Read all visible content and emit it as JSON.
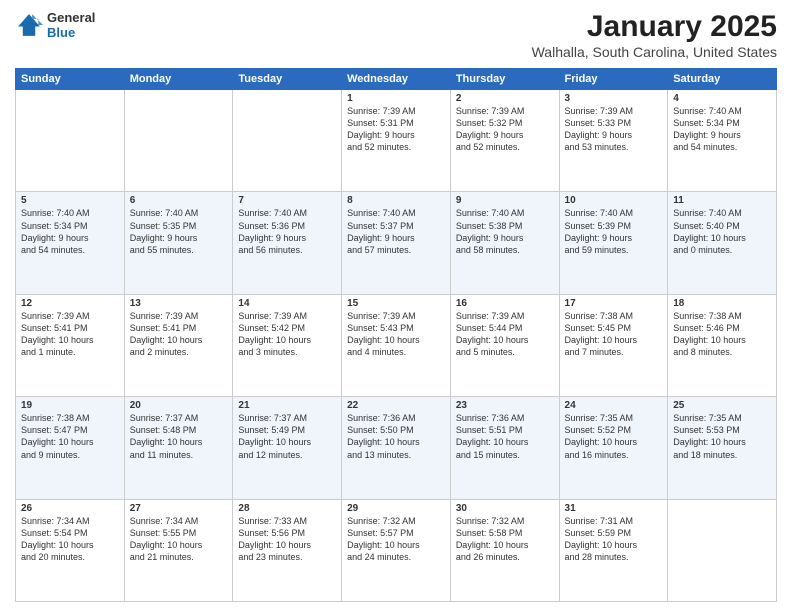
{
  "header": {
    "logo_line1": "General",
    "logo_line2": "Blue",
    "title": "January 2025",
    "subtitle": "Walhalla, South Carolina, United States"
  },
  "days_of_week": [
    "Sunday",
    "Monday",
    "Tuesday",
    "Wednesday",
    "Thursday",
    "Friday",
    "Saturday"
  ],
  "weeks": [
    [
      {
        "day": "",
        "info": ""
      },
      {
        "day": "",
        "info": ""
      },
      {
        "day": "",
        "info": ""
      },
      {
        "day": "1",
        "info": "Sunrise: 7:39 AM\nSunset: 5:31 PM\nDaylight: 9 hours\nand 52 minutes."
      },
      {
        "day": "2",
        "info": "Sunrise: 7:39 AM\nSunset: 5:32 PM\nDaylight: 9 hours\nand 52 minutes."
      },
      {
        "day": "3",
        "info": "Sunrise: 7:39 AM\nSunset: 5:33 PM\nDaylight: 9 hours\nand 53 minutes."
      },
      {
        "day": "4",
        "info": "Sunrise: 7:40 AM\nSunset: 5:34 PM\nDaylight: 9 hours\nand 54 minutes."
      }
    ],
    [
      {
        "day": "5",
        "info": "Sunrise: 7:40 AM\nSunset: 5:34 PM\nDaylight: 9 hours\nand 54 minutes."
      },
      {
        "day": "6",
        "info": "Sunrise: 7:40 AM\nSunset: 5:35 PM\nDaylight: 9 hours\nand 55 minutes."
      },
      {
        "day": "7",
        "info": "Sunrise: 7:40 AM\nSunset: 5:36 PM\nDaylight: 9 hours\nand 56 minutes."
      },
      {
        "day": "8",
        "info": "Sunrise: 7:40 AM\nSunset: 5:37 PM\nDaylight: 9 hours\nand 57 minutes."
      },
      {
        "day": "9",
        "info": "Sunrise: 7:40 AM\nSunset: 5:38 PM\nDaylight: 9 hours\nand 58 minutes."
      },
      {
        "day": "10",
        "info": "Sunrise: 7:40 AM\nSunset: 5:39 PM\nDaylight: 9 hours\nand 59 minutes."
      },
      {
        "day": "11",
        "info": "Sunrise: 7:40 AM\nSunset: 5:40 PM\nDaylight: 10 hours\nand 0 minutes."
      }
    ],
    [
      {
        "day": "12",
        "info": "Sunrise: 7:39 AM\nSunset: 5:41 PM\nDaylight: 10 hours\nand 1 minute."
      },
      {
        "day": "13",
        "info": "Sunrise: 7:39 AM\nSunset: 5:41 PM\nDaylight: 10 hours\nand 2 minutes."
      },
      {
        "day": "14",
        "info": "Sunrise: 7:39 AM\nSunset: 5:42 PM\nDaylight: 10 hours\nand 3 minutes."
      },
      {
        "day": "15",
        "info": "Sunrise: 7:39 AM\nSunset: 5:43 PM\nDaylight: 10 hours\nand 4 minutes."
      },
      {
        "day": "16",
        "info": "Sunrise: 7:39 AM\nSunset: 5:44 PM\nDaylight: 10 hours\nand 5 minutes."
      },
      {
        "day": "17",
        "info": "Sunrise: 7:38 AM\nSunset: 5:45 PM\nDaylight: 10 hours\nand 7 minutes."
      },
      {
        "day": "18",
        "info": "Sunrise: 7:38 AM\nSunset: 5:46 PM\nDaylight: 10 hours\nand 8 minutes."
      }
    ],
    [
      {
        "day": "19",
        "info": "Sunrise: 7:38 AM\nSunset: 5:47 PM\nDaylight: 10 hours\nand 9 minutes."
      },
      {
        "day": "20",
        "info": "Sunrise: 7:37 AM\nSunset: 5:48 PM\nDaylight: 10 hours\nand 11 minutes."
      },
      {
        "day": "21",
        "info": "Sunrise: 7:37 AM\nSunset: 5:49 PM\nDaylight: 10 hours\nand 12 minutes."
      },
      {
        "day": "22",
        "info": "Sunrise: 7:36 AM\nSunset: 5:50 PM\nDaylight: 10 hours\nand 13 minutes."
      },
      {
        "day": "23",
        "info": "Sunrise: 7:36 AM\nSunset: 5:51 PM\nDaylight: 10 hours\nand 15 minutes."
      },
      {
        "day": "24",
        "info": "Sunrise: 7:35 AM\nSunset: 5:52 PM\nDaylight: 10 hours\nand 16 minutes."
      },
      {
        "day": "25",
        "info": "Sunrise: 7:35 AM\nSunset: 5:53 PM\nDaylight: 10 hours\nand 18 minutes."
      }
    ],
    [
      {
        "day": "26",
        "info": "Sunrise: 7:34 AM\nSunset: 5:54 PM\nDaylight: 10 hours\nand 20 minutes."
      },
      {
        "day": "27",
        "info": "Sunrise: 7:34 AM\nSunset: 5:55 PM\nDaylight: 10 hours\nand 21 minutes."
      },
      {
        "day": "28",
        "info": "Sunrise: 7:33 AM\nSunset: 5:56 PM\nDaylight: 10 hours\nand 23 minutes."
      },
      {
        "day": "29",
        "info": "Sunrise: 7:32 AM\nSunset: 5:57 PM\nDaylight: 10 hours\nand 24 minutes."
      },
      {
        "day": "30",
        "info": "Sunrise: 7:32 AM\nSunset: 5:58 PM\nDaylight: 10 hours\nand 26 minutes."
      },
      {
        "day": "31",
        "info": "Sunrise: 7:31 AM\nSunset: 5:59 PM\nDaylight: 10 hours\nand 28 minutes."
      },
      {
        "day": "",
        "info": ""
      }
    ]
  ]
}
